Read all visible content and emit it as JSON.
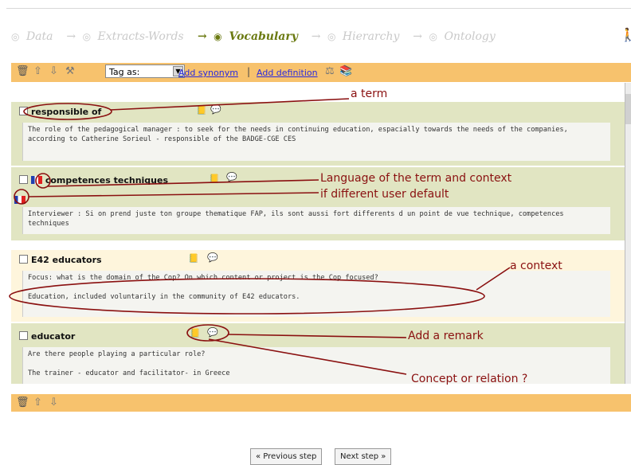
{
  "steps": [
    {
      "label": "Data",
      "active": false
    },
    {
      "label": "Extracts-Words",
      "active": false
    },
    {
      "label": "Vocabulary",
      "active": true
    },
    {
      "label": "Hierarchy",
      "active": false
    },
    {
      "label": "Ontology",
      "active": false
    }
  ],
  "toolbar": {
    "tag_select_value": "Tag as:",
    "add_synonym": "Add synonym",
    "separator": "|",
    "add_definition": "Add definition"
  },
  "entries": [
    {
      "term": "responsible of",
      "context": "The role of the  pedagogical manager : to seek for the needs in continuing education, espacially towards the needs of the  companies, according to Catherine Sorieul -  responsible of the BADGE-CGE CES"
    },
    {
      "term": "competences techniques",
      "context": "Interviewer : Si on prend juste ton groupe thematique FAP, ils sont aussi fort differents d un point de vue technique,  competences techniques"
    },
    {
      "term": "E42 educators",
      "context": "Focus: what is the domain of the Cop? On which content or project is the Cop focused?\n\nEducation, included voluntarily in the community of  E42 educators."
    },
    {
      "term": "educator",
      "context": "Are there people playing a particular role?\n\nThe trainer - educator and  facilitator- in Greece"
    }
  ],
  "annotations": {
    "a_term": "a term",
    "language": "Language of the term and context",
    "language2": "if different user default",
    "a_context": "a context",
    "add_remark": "Add a remark",
    "concept_relation": "Concept or relation ?"
  },
  "buttons": {
    "previous": "« Previous step",
    "next": "Next step »"
  },
  "colors": {
    "toolbar": "#f7c26d",
    "entry_green": "#e1e5c2",
    "entry_cream": "#fef5dc",
    "annotation": "#8a1010",
    "active_step": "#6b7a12"
  }
}
